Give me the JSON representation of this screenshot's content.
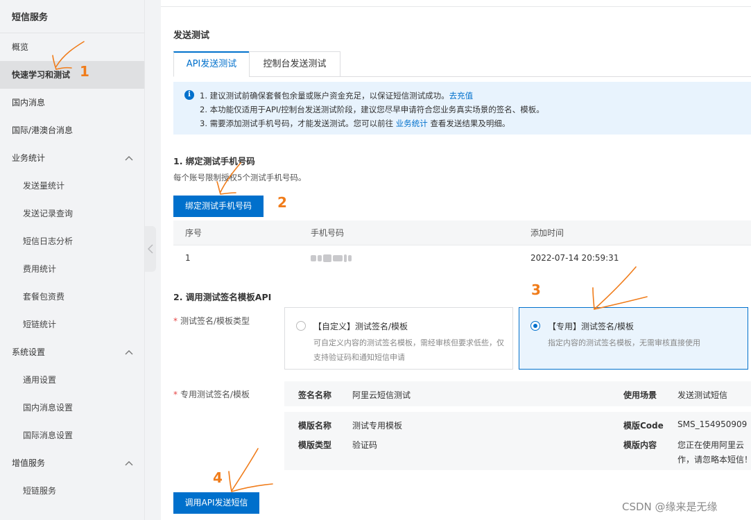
{
  "sidebar": {
    "title": "短信服务",
    "items": [
      {
        "label": "概览",
        "sub": false
      },
      {
        "label": "快速学习和测试",
        "sub": false,
        "active": true
      },
      {
        "label": "国内消息",
        "sub": false
      },
      {
        "label": "国际/港澳台消息",
        "sub": false
      },
      {
        "label": "业务统计",
        "sub": false,
        "expandable": true
      },
      {
        "label": "发送量统计",
        "sub": true
      },
      {
        "label": "发送记录查询",
        "sub": true
      },
      {
        "label": "短信日志分析",
        "sub": true
      },
      {
        "label": "费用统计",
        "sub": true
      },
      {
        "label": "套餐包资费",
        "sub": true
      },
      {
        "label": "短链统计",
        "sub": true
      },
      {
        "label": "系统设置",
        "sub": false,
        "expandable": true
      },
      {
        "label": "通用设置",
        "sub": true
      },
      {
        "label": "国内消息设置",
        "sub": true
      },
      {
        "label": "国际消息设置",
        "sub": true
      },
      {
        "label": "增值服务",
        "sub": false,
        "expandable": true
      },
      {
        "label": "短链服务",
        "sub": true
      }
    ]
  },
  "main": {
    "section_title": "发送测试",
    "tabs": [
      {
        "label": "API发送测试",
        "active": true
      },
      {
        "label": "控制台发送测试",
        "active": false
      }
    ],
    "notice": {
      "line1_text": "1. 建议测试前确保套餐包余量或账户资金充足，以保证短信测试成功。",
      "line1_link": "去充值",
      "line2_text": "2. 本功能仅适用于API/控制台发送测试阶段，建议您尽早申请符合您业务真实场景的签名、模板。",
      "line3_prefix": "3. 需要添加测试手机号码，才能发送测试。您可以前往",
      "line3_link": "业务统计",
      "line3_suffix": "查看发送结果及明细。"
    },
    "step1": {
      "title": "1. 绑定测试手机号码",
      "desc": "每个账号限制授权5个测试手机号码。",
      "button": "绑定测试手机号码",
      "table": {
        "headers": [
          "序号",
          "手机号码",
          "添加时间"
        ],
        "rows": [
          {
            "index": "1",
            "time": "2022-07-14 20:59:31"
          }
        ]
      }
    },
    "step2": {
      "title": "2. 调用测试签名模板API",
      "type_label": "测试签名/模板类型",
      "options": [
        {
          "title": "【自定义】测试签名/模板",
          "desc": "可自定义内容的测试签名模板，需经审核但要求低些，仅支持验证码和通知短信申请",
          "selected": false
        },
        {
          "title": "【专用】测试签名/模板",
          "desc": "指定内容的测试签名模板，无需审核直接使用",
          "selected": true
        }
      ],
      "template_label": "专用测试签名/模板",
      "sign_key": "签名名称",
      "sign_value": "阿里云短信测试",
      "scene_key": "使用场景",
      "scene_value": "发送测试短信",
      "tpl_name_key": "模版名称",
      "tpl_name_value": "测试专用模板",
      "tpl_type_key": "模版类型",
      "tpl_type_value": "验证码",
      "tpl_code_key": "模版Code",
      "tpl_code_value": "SMS_154950909",
      "tpl_content_key": "模版内容",
      "tpl_content_line1": "您正在使用阿里云",
      "tpl_content_line2": "作，请忽略本短信！",
      "button": "调用API发送短信"
    }
  },
  "annotations": {
    "n1": "1",
    "n2": "2",
    "n3": "3",
    "n4": "4",
    "color": "#f07c1a"
  },
  "watermark": "CSDN @缘来是无缘",
  "colors": {
    "accent": "#0070cc",
    "notice_bg": "#e8f3fd",
    "required": "#e54545"
  }
}
